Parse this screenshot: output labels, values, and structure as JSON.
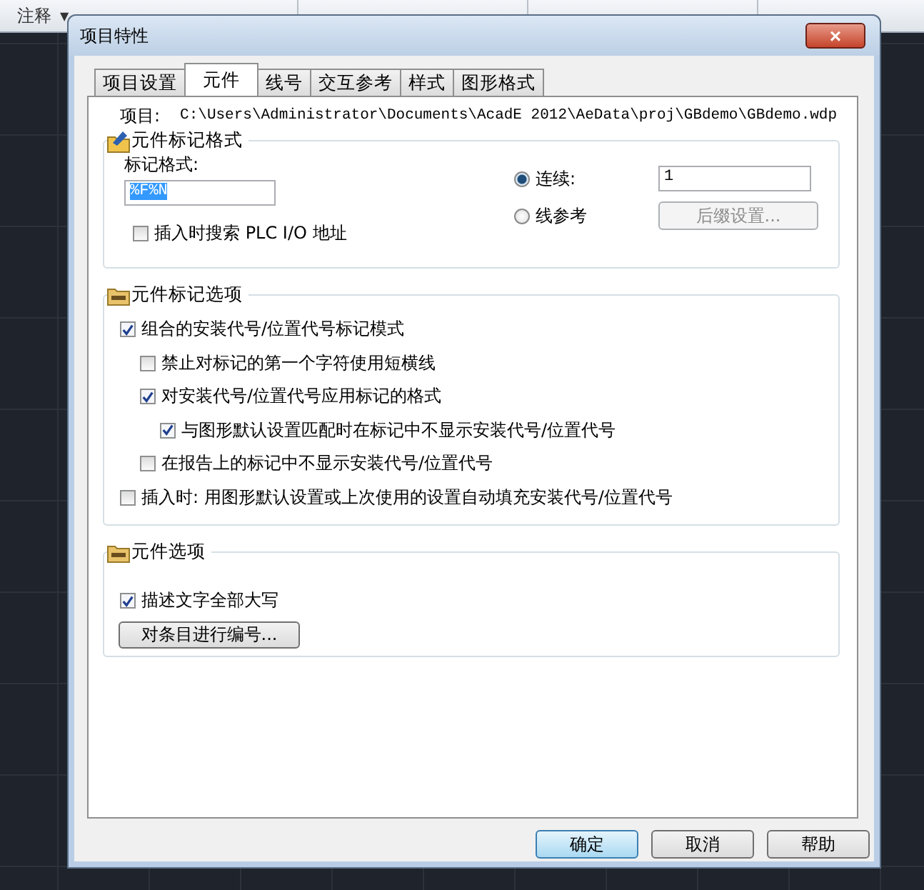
{
  "ribbon": {
    "panel_label": "注释",
    "dropdown": "▼"
  },
  "dialog": {
    "title": "项目特性",
    "close": "×"
  },
  "tabs": [
    {
      "label": "项目设置",
      "selected": false
    },
    {
      "label": "元件",
      "selected": true
    },
    {
      "label": "线号",
      "selected": false
    },
    {
      "label": "交互参考",
      "selected": false
    },
    {
      "label": "样式",
      "selected": false
    },
    {
      "label": "图形格式",
      "selected": false
    }
  ],
  "project": {
    "label": "项目:",
    "path": "C:\\Users\\Administrator\\Documents\\AcadE 2012\\AeData\\proj\\GBdemo\\GBdemo.wdp"
  },
  "tag_format": {
    "title": "元件标记格式",
    "field_label": "标记格式:",
    "value": "%F%N",
    "plc_search": {
      "label": "插入时搜索 PLC I/O 地址",
      "checked": false
    },
    "radios": [
      {
        "label": "连续:",
        "selected": true
      },
      {
        "label": "线参考",
        "selected": false
      }
    ],
    "start_value": "1",
    "suffix_button": {
      "label": "后缀设置...",
      "disabled": true
    }
  },
  "tag_options": {
    "title": "元件标记选项",
    "items": [
      {
        "label": "组合的安装代号/位置代号标记模式",
        "checked": true,
        "children": [
          {
            "label": "禁止对标记的第一个字符使用短横线",
            "checked": false
          },
          {
            "label": "对安装代号/位置代号应用标记的格式",
            "checked": true,
            "children": [
              {
                "label": "与图形默认设置匹配时在标记中不显示安装代号/位置代号",
                "checked": true
              }
            ]
          },
          {
            "label": "在报告上的标记中不显示安装代号/位置代号",
            "checked": false
          }
        ]
      },
      {
        "label": "插入时: 用图形默认设置或上次使用的设置自动填充安装代号/位置代号",
        "checked": false
      }
    ]
  },
  "component_options": {
    "title": "元件选项",
    "uppercase": {
      "label": "描述文字全部大写",
      "checked": true
    },
    "renumber_button": "对条目进行编号..."
  },
  "buttons": [
    {
      "label": "确定",
      "default": true
    },
    {
      "label": "取消",
      "default": false
    },
    {
      "label": "帮助",
      "default": false
    }
  ]
}
